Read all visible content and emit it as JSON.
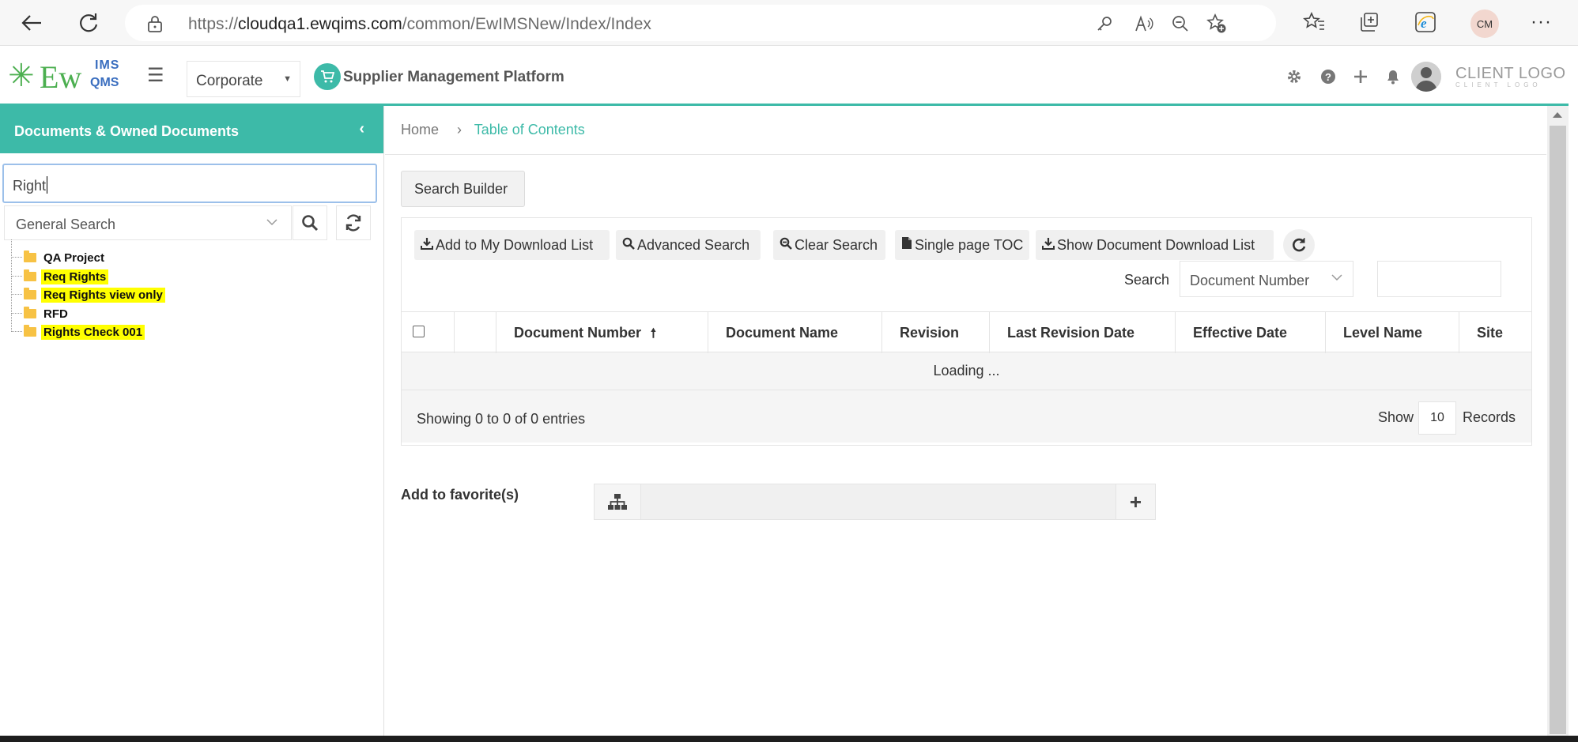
{
  "browser": {
    "url_prefix": "https://",
    "url_host": "cloudqa1.ewqims.com",
    "url_path": "/common/EwIMSNew/Index/Index",
    "profile_initials": "CM"
  },
  "header": {
    "logo_ims": "IMS",
    "logo_qms": "QMS",
    "logo_ew": "Ew",
    "org_selected": "Corporate",
    "platform_name": "Supplier Management Platform",
    "client_logo": "CLIENT LOGO",
    "client_logo_sub": "CLIENT LOGO"
  },
  "sidebar": {
    "title": "Documents & Owned Documents",
    "search_value": "Right",
    "search_type": "General Search",
    "tree": [
      {
        "label": "QA Project",
        "highlight": false
      },
      {
        "label": "Req Rights",
        "highlight": true
      },
      {
        "label": "Req Rights view only",
        "highlight": true
      },
      {
        "label": "RFD",
        "highlight": false
      },
      {
        "label": "Rights Check 001",
        "highlight": true
      }
    ]
  },
  "main": {
    "breadcrumb": {
      "home": "Home",
      "current": "Table of Contents"
    },
    "search_builder": "Search Builder",
    "toolbar": {
      "add_download": "Add to My Download List",
      "advanced_search": "Advanced Search",
      "clear_search": "Clear Search",
      "single_page_toc": "Single page TOC",
      "show_download": "Show Document Download List"
    },
    "search": {
      "label": "Search",
      "field": "Document Number",
      "value": ""
    },
    "columns": [
      "Document Number",
      "Document Name",
      "Revision",
      "Last Revision Date",
      "Effective Date",
      "Level Name",
      "Site"
    ],
    "loading": "Loading ...",
    "footer": {
      "showing": "Showing 0 to 0 of 0 entries",
      "show": "Show",
      "page_size": "10",
      "records": "Records"
    },
    "favorites_label": "Add to favorite(s)"
  }
}
